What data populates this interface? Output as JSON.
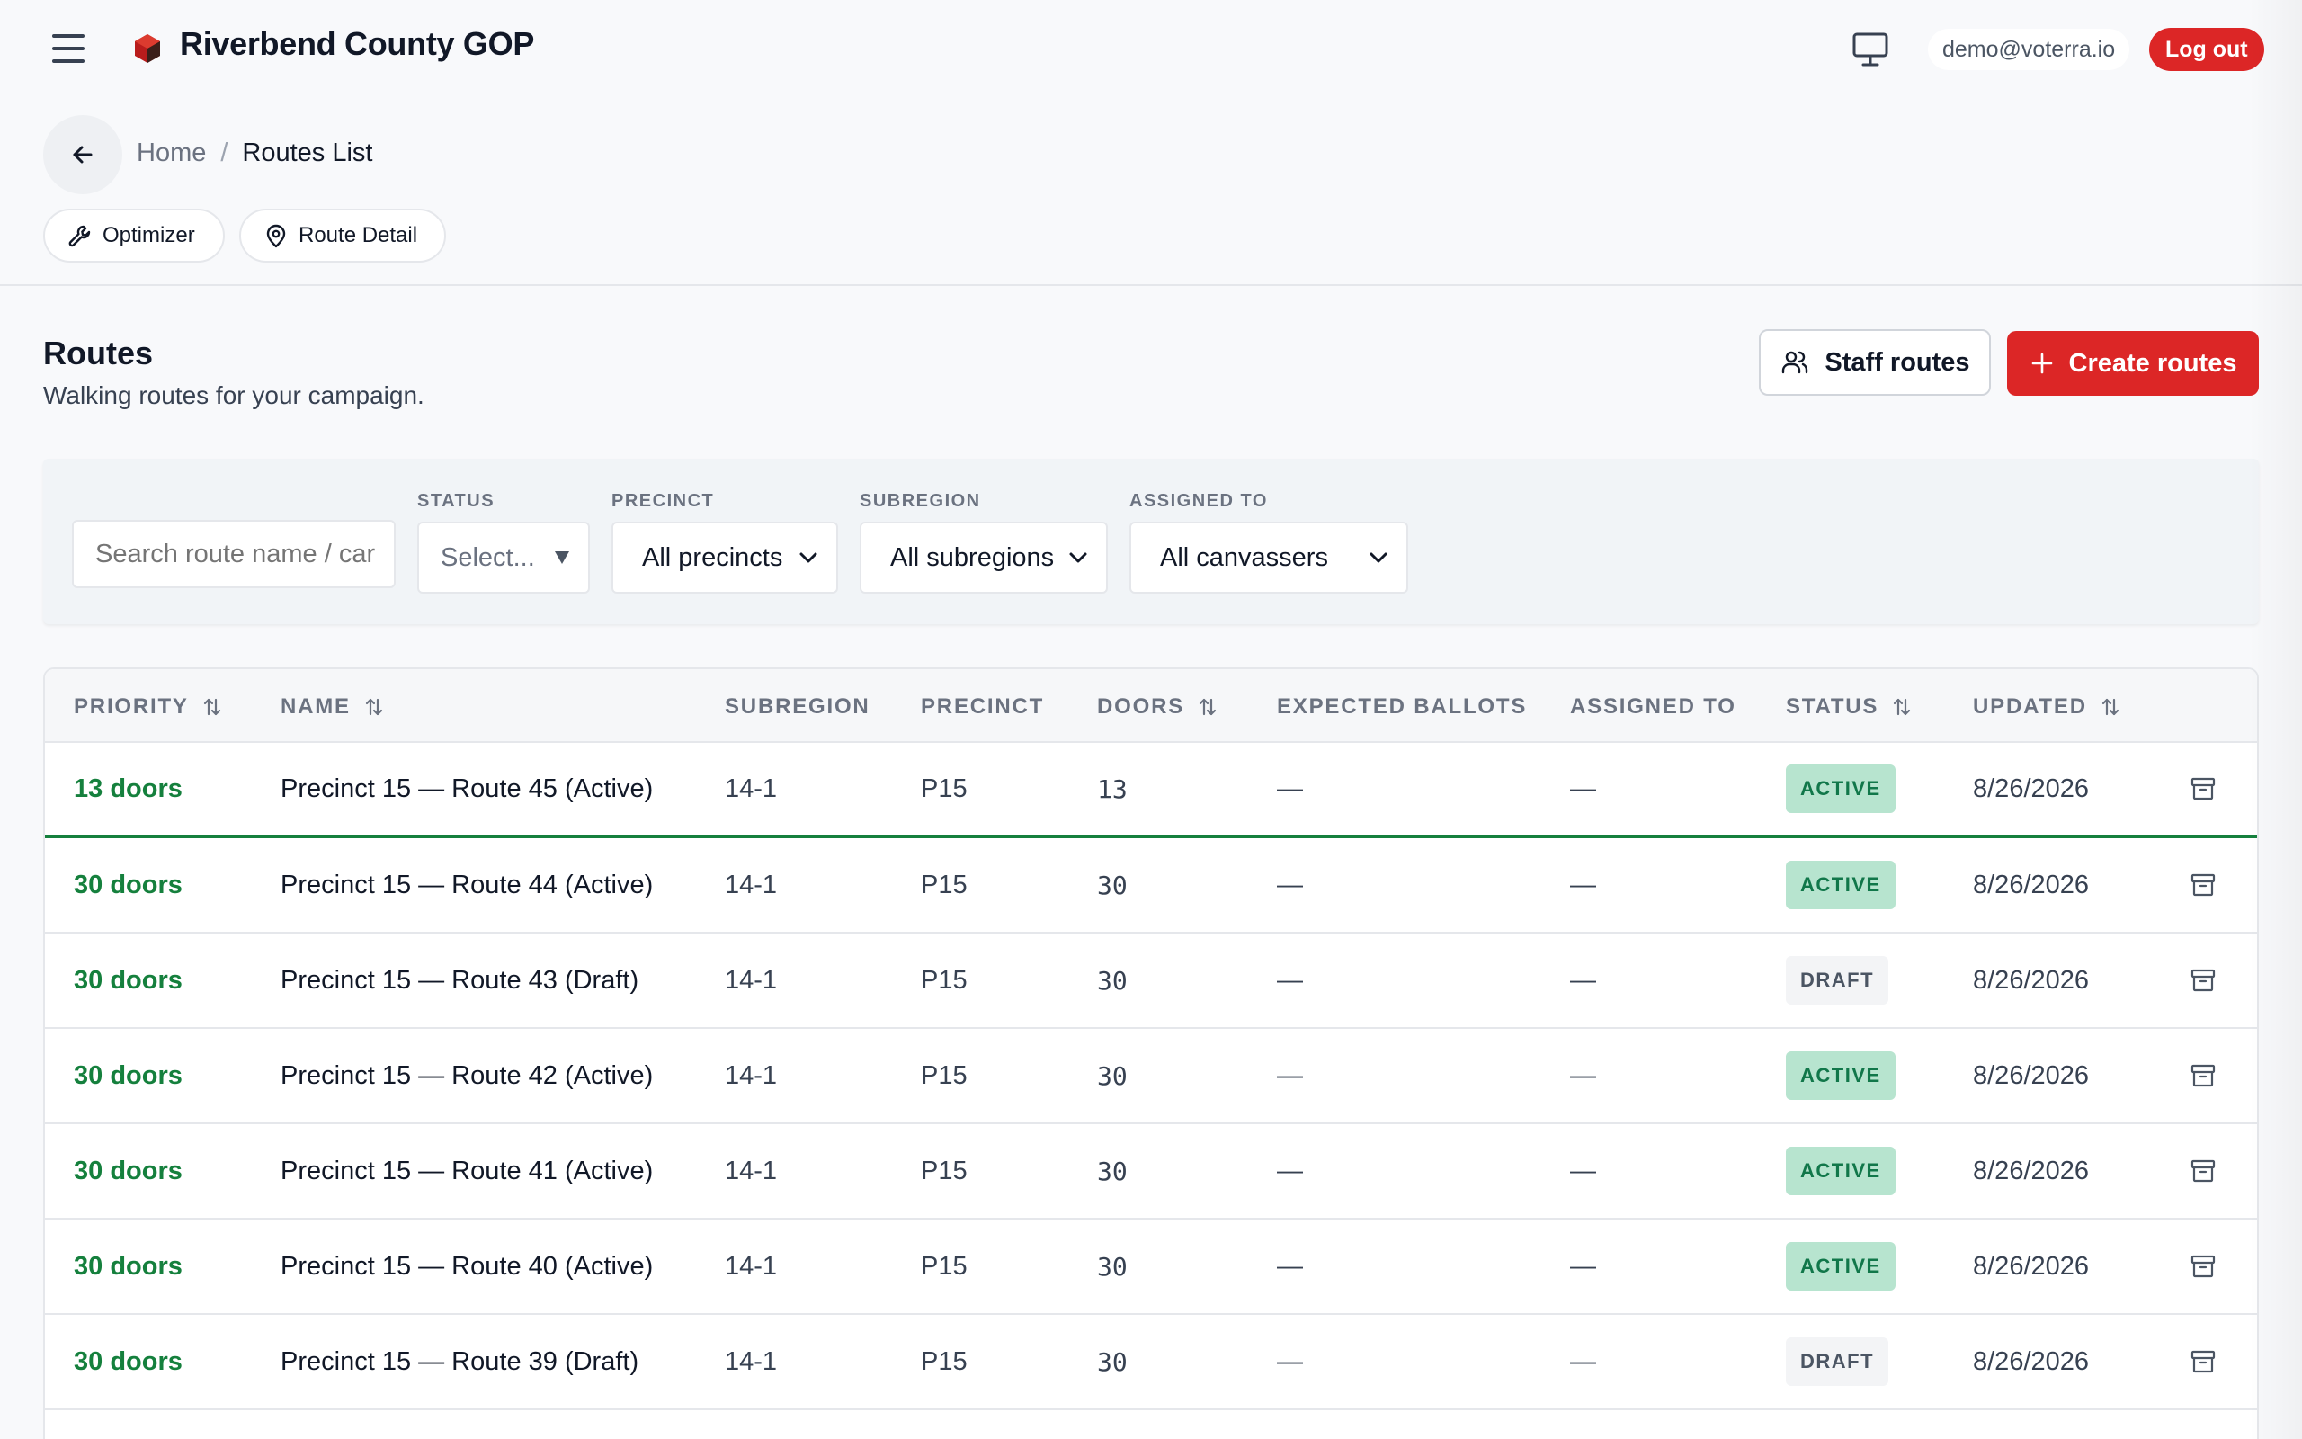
{
  "header": {
    "org_name": "Riverbend County GOP",
    "user_email": "demo@voterra.io",
    "logout_label": "Log out",
    "brand_color": "#dc2626"
  },
  "breadcrumb": {
    "home": "Home",
    "separator": "/",
    "current": "Routes List"
  },
  "quick_links": [
    {
      "label": "Optimizer",
      "icon": "wrench-icon"
    },
    {
      "label": "Route Detail",
      "icon": "map-pin-icon"
    }
  ],
  "section": {
    "title": "Routes",
    "subtitle": "Walking routes for your campaign.",
    "staff_button": "Staff routes",
    "create_button": "Create routes"
  },
  "filters": {
    "search_placeholder": "Search route name / car",
    "status_label": "STATUS",
    "status_value": "Select...",
    "precinct_label": "PRECINCT",
    "precinct_value": "All precincts",
    "subregion_label": "SUBREGION",
    "subregion_value": "All subregions",
    "assigned_label": "ASSIGNED TO",
    "assigned_value": "All canvassers"
  },
  "table": {
    "columns": {
      "priority": "PRIORITY",
      "name": "NAME",
      "subregion": "SUBREGION",
      "precinct": "PRECINCT",
      "doors": "DOORS",
      "expected": "EXPECTED BALLOTS",
      "assigned": "ASSIGNED TO",
      "status": "STATUS",
      "updated": "UPDATED"
    },
    "rows": [
      {
        "priority": "13 doors",
        "name": "Precinct 15 — Route 45 (Active)",
        "subregion": "14-1",
        "precinct": "P15",
        "doors": "13",
        "expected": "—",
        "assigned": "—",
        "status": "ACTIVE",
        "updated": "8/26/2026"
      },
      {
        "priority": "30 doors",
        "name": "Precinct 15 — Route 44 (Active)",
        "subregion": "14-1",
        "precinct": "P15",
        "doors": "30",
        "expected": "—",
        "assigned": "—",
        "status": "ACTIVE",
        "updated": "8/26/2026"
      },
      {
        "priority": "30 doors",
        "name": "Precinct 15 — Route 43 (Draft)",
        "subregion": "14-1",
        "precinct": "P15",
        "doors": "30",
        "expected": "—",
        "assigned": "—",
        "status": "DRAFT",
        "updated": "8/26/2026"
      },
      {
        "priority": "30 doors",
        "name": "Precinct 15 — Route 42 (Active)",
        "subregion": "14-1",
        "precinct": "P15",
        "doors": "30",
        "expected": "—",
        "assigned": "—",
        "status": "ACTIVE",
        "updated": "8/26/2026"
      },
      {
        "priority": "30 doors",
        "name": "Precinct 15 — Route 41 (Active)",
        "subregion": "14-1",
        "precinct": "P15",
        "doors": "30",
        "expected": "—",
        "assigned": "—",
        "status": "ACTIVE",
        "updated": "8/26/2026"
      },
      {
        "priority": "30 doors",
        "name": "Precinct 15 — Route 40 (Active)",
        "subregion": "14-1",
        "precinct": "P15",
        "doors": "30",
        "expected": "—",
        "assigned": "—",
        "status": "ACTIVE",
        "updated": "8/26/2026"
      },
      {
        "priority": "30 doors",
        "name": "Precinct 15 — Route 39 (Draft)",
        "subregion": "14-1",
        "precinct": "P15",
        "doors": "30",
        "expected": "—",
        "assigned": "—",
        "status": "DRAFT",
        "updated": "8/26/2026"
      }
    ]
  }
}
